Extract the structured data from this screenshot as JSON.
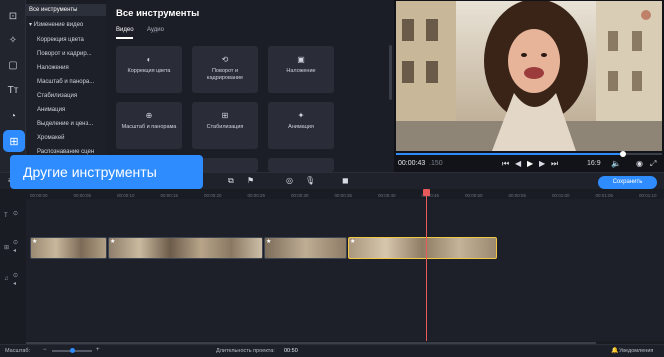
{
  "sidebar": {
    "icons": [
      "import-icon",
      "magic-wand-icon",
      "filters-icon",
      "titles-icon",
      "transitions-icon",
      "more-tools-icon"
    ]
  },
  "categories": [
    {
      "label": "Все инструменты",
      "selected": true
    },
    {
      "label": "Изменение видео",
      "sub": true
    },
    {
      "label": "Коррекция цвета"
    },
    {
      "label": "Поворот и кадрир..."
    },
    {
      "label": "Наложения"
    },
    {
      "label": "Масштаб и панора..."
    },
    {
      "label": "Стабилизация"
    },
    {
      "label": "Анимация"
    },
    {
      "label": "Выделение и ценз..."
    },
    {
      "label": "Хромакей"
    },
    {
      "label": "Распознавание сцен"
    }
  ],
  "tools": {
    "title": "Все инструменты",
    "tabs": [
      "Видео",
      "Аудио"
    ],
    "cards": [
      {
        "icon": "◐",
        "label": "Коррекция цвета"
      },
      {
        "icon": "⟲",
        "label": "Поворот и кадрирование"
      },
      {
        "icon": "▣",
        "label": "Наложение"
      },
      {
        "icon": "⊕",
        "label": "Масштаб и панорама"
      },
      {
        "icon": "⊞",
        "label": "Стабилизация"
      },
      {
        "icon": "✦",
        "label": "Анимация"
      }
    ]
  },
  "player": {
    "time_current": "00:00:43",
    "time_ms": ".150",
    "aspect": "16:9"
  },
  "tooltip": "Другие инструменты",
  "save_label": "Сохранить",
  "ruler_ticks": [
    "00:00:00",
    "00:00:05",
    "00:00:10",
    "00:00:15",
    "00:00:20",
    "00:00:25",
    "00:00:30",
    "00:00:35",
    "00:00:40",
    "00:00:45",
    "00:00:50",
    "00:00:55",
    "00:01:00",
    "00:01:05",
    "00:01:10"
  ],
  "status": {
    "zoom_label": "Масштаб:",
    "duration_label": "Длительность проекта:",
    "duration_value": "00:50",
    "notifications": "Уведомления"
  },
  "colors": {
    "accent": "#2e8cff",
    "playhead": "#e85a5a",
    "selected_clip": "#f2c744"
  }
}
